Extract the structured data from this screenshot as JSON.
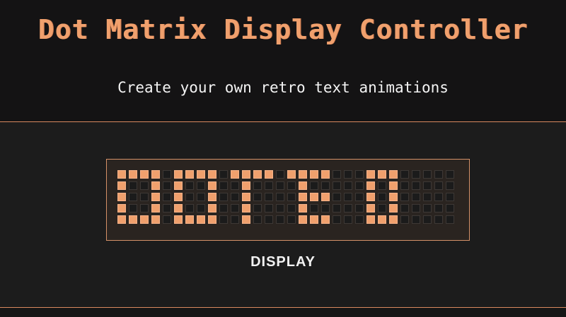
{
  "header": {
    "title": "Dot Matrix Display Controller",
    "subtitle": "Create your own retro text animations"
  },
  "display": {
    "label": "DISPLAY",
    "columns": 30,
    "rows": 5,
    "matrix": [
      "111101111011110111100011100000",
      "100101001001000010000010100000",
      "100101001001000011100010100000",
      "100101001001000010000010100000",
      "111101111001000011100011100000"
    ]
  },
  "colors": {
    "accent": "#f0a06d",
    "dot_on": "#f0a06d",
    "dot_off": "#1b1b1b",
    "header_bg": "#141314",
    "panel_bg": "#2a2420",
    "text": "#f4f4f4"
  }
}
